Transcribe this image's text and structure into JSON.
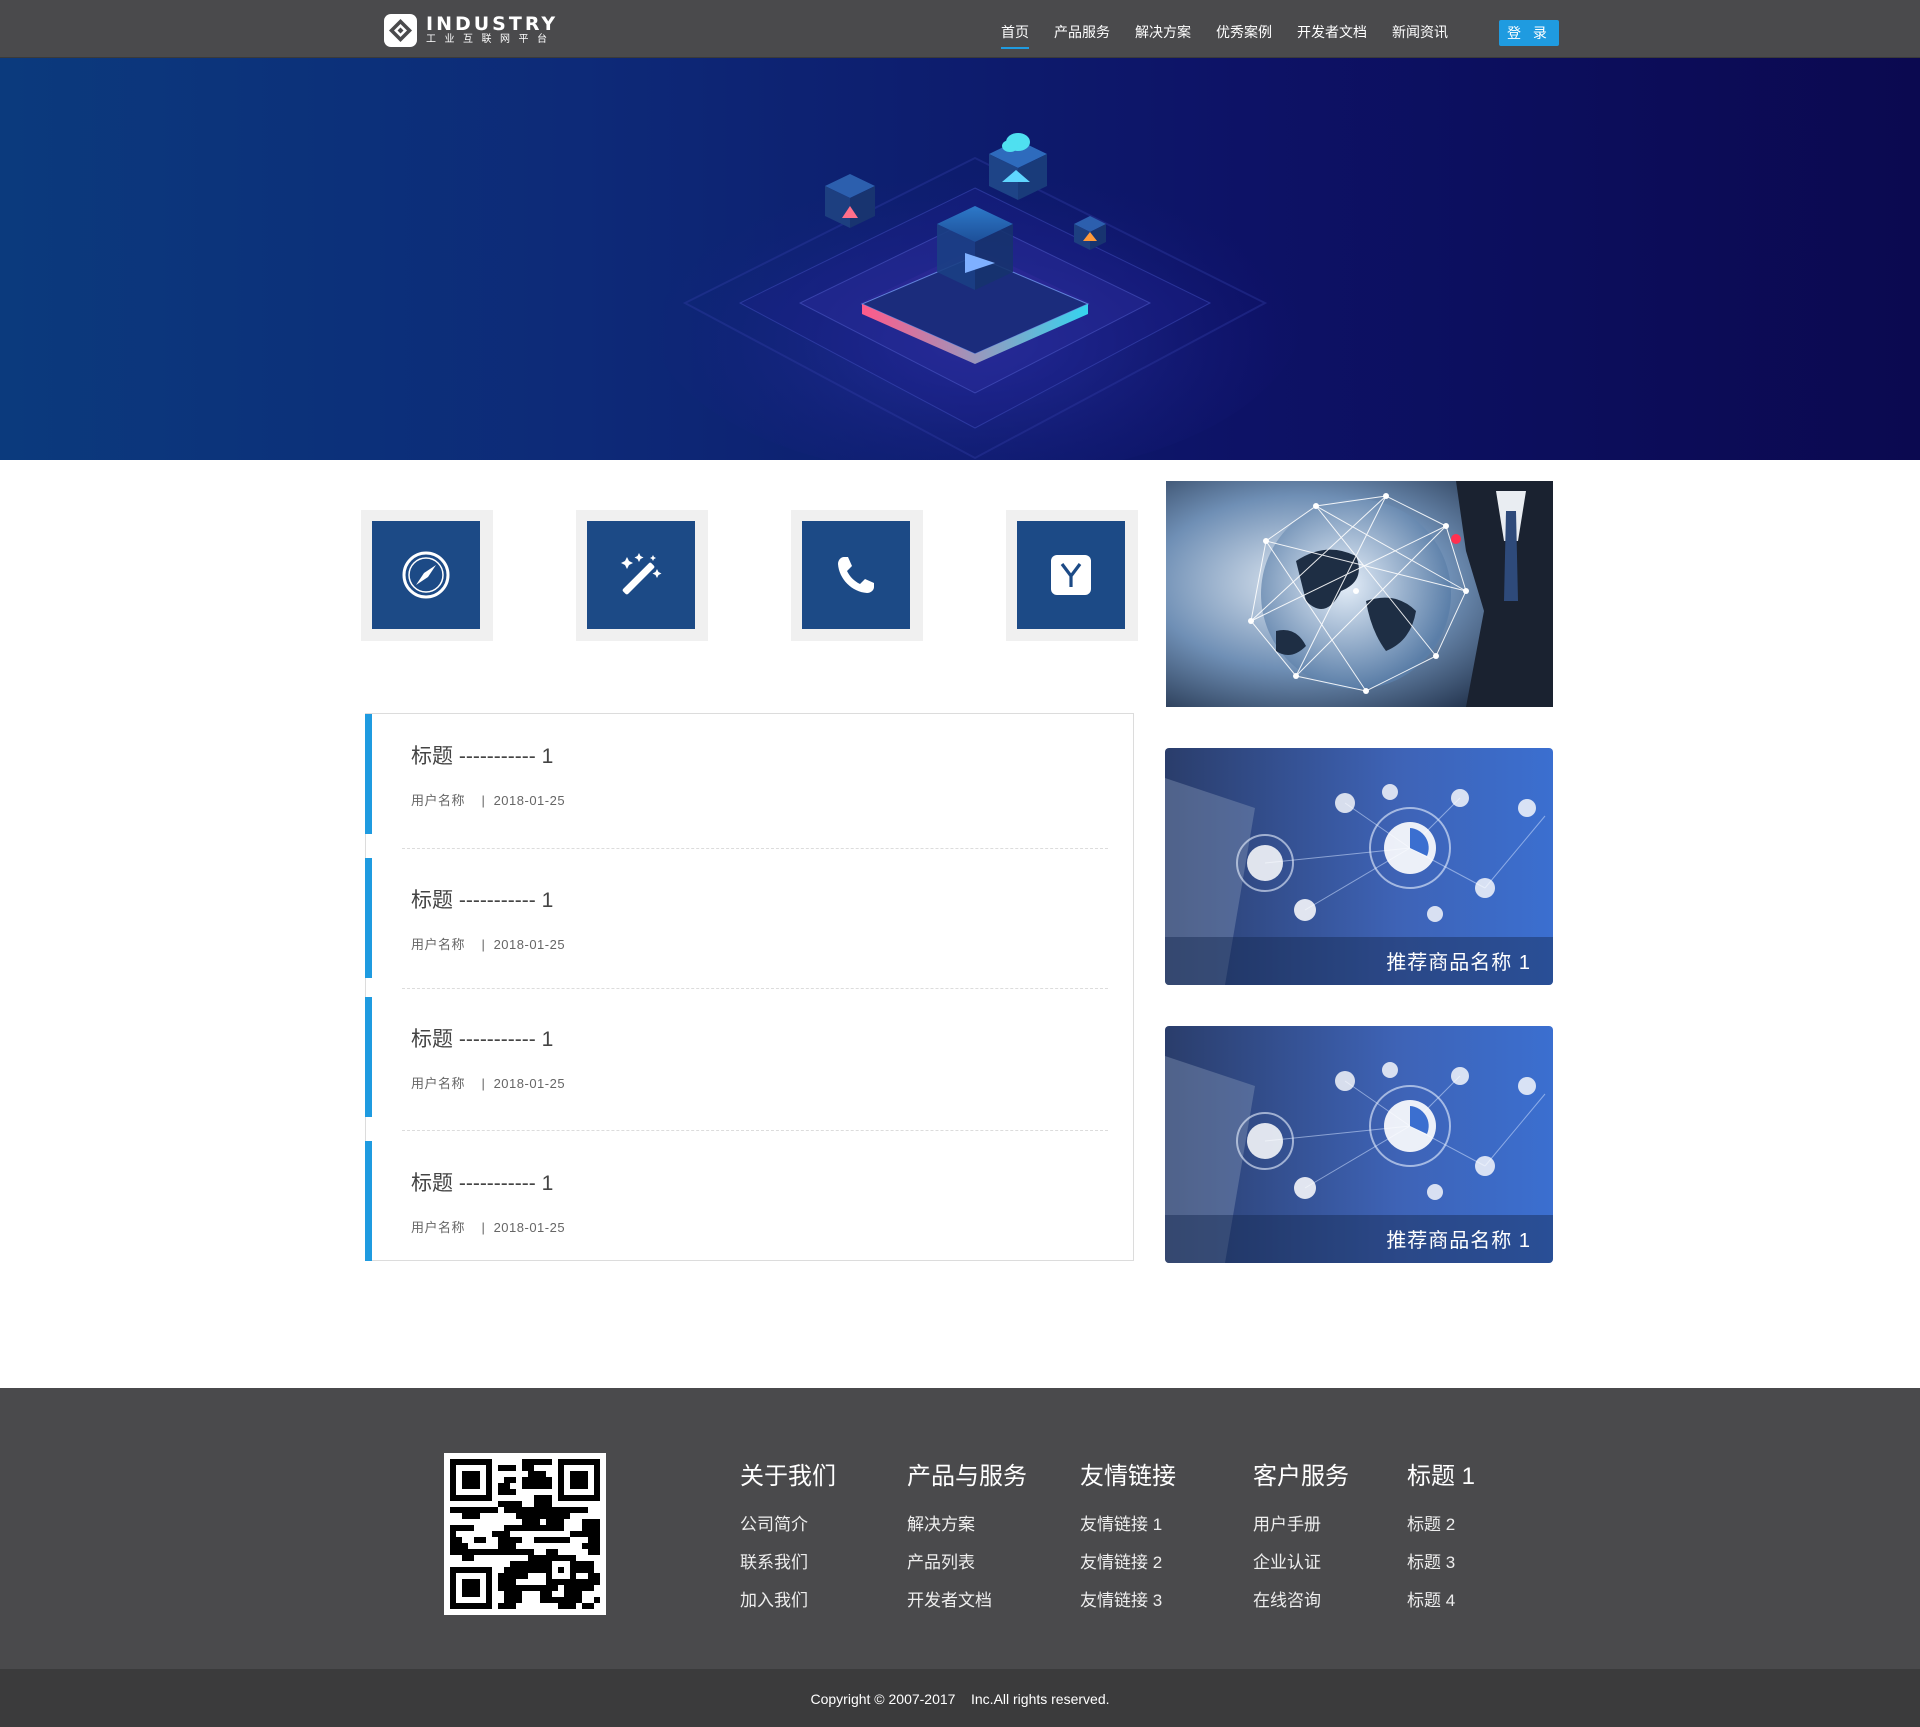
{
  "header": {
    "logo": {
      "title": "INDUSTRY",
      "subtitle": "工业互联网平台"
    },
    "nav": [
      {
        "label": "首页",
        "active": true
      },
      {
        "label": "产品服务",
        "active": false
      },
      {
        "label": "解决方案",
        "active": false
      },
      {
        "label": "优秀案例",
        "active": false
      },
      {
        "label": "开发者文档",
        "active": false
      },
      {
        "label": "新闻资讯",
        "active": false
      }
    ],
    "login_label": "登 录"
  },
  "features": [
    {
      "icon": "compass-icon"
    },
    {
      "icon": "magic-wand-icon"
    },
    {
      "icon": "phone-icon"
    },
    {
      "icon": "y-letter-icon"
    }
  ],
  "news": [
    {
      "title": "标题 ----------- 1",
      "author": "用户名称",
      "date": "2018-01-25"
    },
    {
      "title": "标题 ----------- 1",
      "author": "用户名称",
      "date": "2018-01-25"
    },
    {
      "title": "标题 ----------- 1",
      "author": "用户名称",
      "date": "2018-01-25"
    },
    {
      "title": "标题 ----------- 1",
      "author": "用户名称",
      "date": "2018-01-25"
    }
  ],
  "recommend": [
    {
      "name": "推荐商品名称 1"
    },
    {
      "name": "推荐商品名称 1"
    }
  ],
  "footer": {
    "columns": [
      {
        "title": "关于我们",
        "links": [
          "公司简介",
          "联系我们",
          "加入我们"
        ]
      },
      {
        "title": "产品与服务",
        "links": [
          "解决方案",
          "产品列表",
          "开发者文档"
        ]
      },
      {
        "title": "友情链接",
        "links": [
          "友情链接 1",
          "友情链接 2",
          "友情链接 3"
        ]
      },
      {
        "title": "客户服务",
        "links": [
          "用户手册",
          "企业认证",
          "在线咨询"
        ]
      },
      {
        "title": "标题 1",
        "links": [
          "标题 2",
          "标题 3",
          "标题 4"
        ]
      }
    ],
    "copyright": "Copyright © 2007-2017    Inc.All rights reserved."
  },
  "colors": {
    "accent": "#1f9be0",
    "tile": "#1c4a86",
    "header_bg": "#4a4a4c",
    "footer_bg": "#4a4a4c",
    "copyright_bg": "#3b3b3c"
  }
}
